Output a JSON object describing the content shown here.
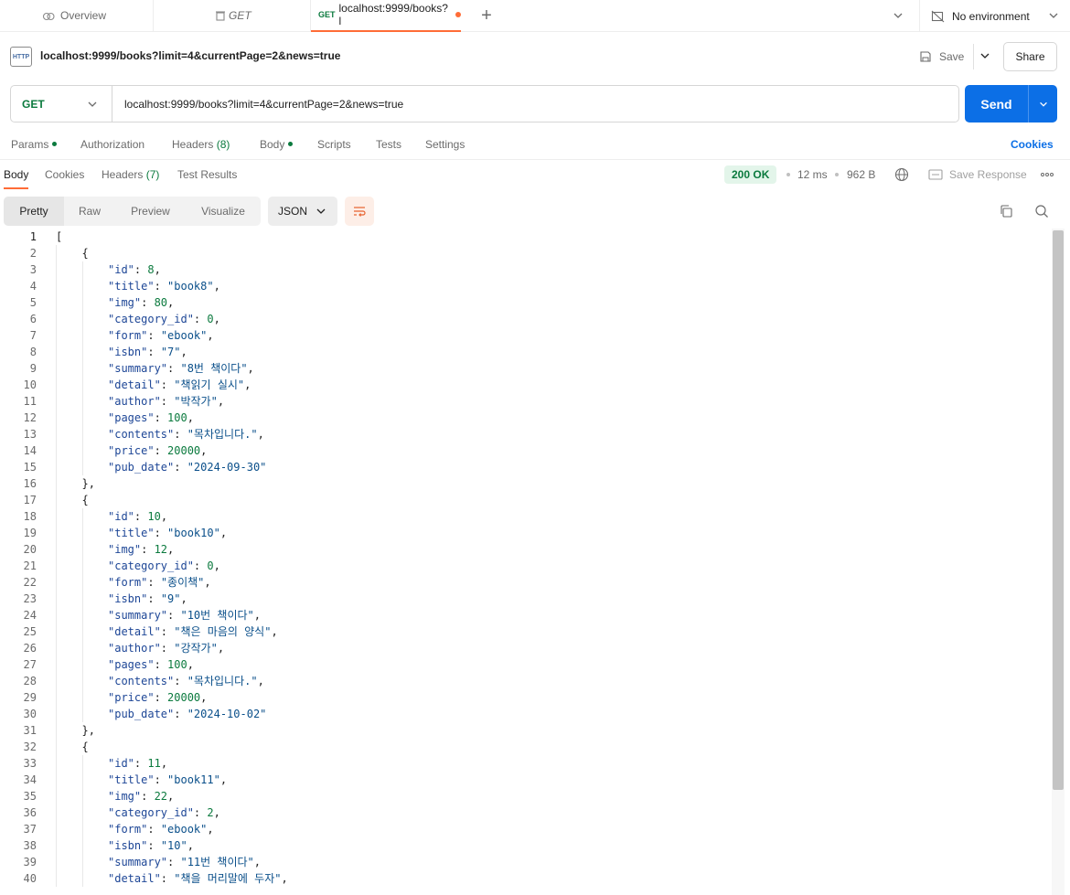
{
  "tabs": {
    "overview_label": "Overview",
    "get_label": "GET",
    "active": {
      "method": "GET",
      "label": "localhost:9999/books?l"
    }
  },
  "environment": {
    "label": "No environment"
  },
  "request": {
    "title": "localhost:9999/books?limit=4&currentPage=2&news=true",
    "http_badge": "HTTP",
    "save_label": "Save",
    "share_label": "Share",
    "method": "GET",
    "url": "localhost:9999/books?limit=4&currentPage=2&news=true",
    "send_label": "Send"
  },
  "request_tabs": {
    "params": "Params",
    "authorization": "Authorization",
    "headers": "Headers",
    "headers_count": "(8)",
    "body": "Body",
    "scripts": "Scripts",
    "tests": "Tests",
    "settings": "Settings",
    "cookies": "Cookies"
  },
  "response_tabs": {
    "body": "Body",
    "cookies": "Cookies",
    "headers": "Headers",
    "headers_count": "(7)",
    "test_results": "Test Results",
    "status": "200 OK",
    "time": "12 ms",
    "size": "962 B",
    "save_response": "Save Response"
  },
  "viewer": {
    "modes": [
      "Pretty",
      "Raw",
      "Preview",
      "Visualize"
    ],
    "format": "JSON"
  },
  "colors": {
    "accent": "#ff6c37",
    "send": "#0c6fe6",
    "status_ok": "#0b7a3e"
  },
  "code_lines": [
    {
      "indent": 0,
      "text": "["
    },
    {
      "indent": 1,
      "text": "{"
    },
    {
      "indent": 2,
      "key": "id",
      "value": "8",
      "type": "n",
      "comma": true
    },
    {
      "indent": 2,
      "key": "title",
      "value": "\"book8\"",
      "type": "s",
      "comma": true
    },
    {
      "indent": 2,
      "key": "img",
      "value": "80",
      "type": "n",
      "comma": true
    },
    {
      "indent": 2,
      "key": "category_id",
      "value": "0",
      "type": "n",
      "comma": true
    },
    {
      "indent": 2,
      "key": "form",
      "value": "\"ebook\"",
      "type": "s",
      "comma": true
    },
    {
      "indent": 2,
      "key": "isbn",
      "value": "\"7\"",
      "type": "s",
      "comma": true
    },
    {
      "indent": 2,
      "key": "summary",
      "value": "\"8번 책이다\"",
      "type": "s",
      "comma": true
    },
    {
      "indent": 2,
      "key": "detail",
      "value": "\"책읽기 실시\"",
      "type": "s",
      "comma": true
    },
    {
      "indent": 2,
      "key": "author",
      "value": "\"박작가\"",
      "type": "s",
      "comma": true
    },
    {
      "indent": 2,
      "key": "pages",
      "value": "100",
      "type": "n",
      "comma": true
    },
    {
      "indent": 2,
      "key": "contents",
      "value": "\"목차입니다.\"",
      "type": "s",
      "comma": true
    },
    {
      "indent": 2,
      "key": "price",
      "value": "20000",
      "type": "n",
      "comma": true
    },
    {
      "indent": 2,
      "key": "pub_date",
      "value": "\"2024-09-30\"",
      "type": "s",
      "comma": false
    },
    {
      "indent": 1,
      "text": "},"
    },
    {
      "indent": 1,
      "text": "{"
    },
    {
      "indent": 2,
      "key": "id",
      "value": "10",
      "type": "n",
      "comma": true
    },
    {
      "indent": 2,
      "key": "title",
      "value": "\"book10\"",
      "type": "s",
      "comma": true
    },
    {
      "indent": 2,
      "key": "img",
      "value": "12",
      "type": "n",
      "comma": true
    },
    {
      "indent": 2,
      "key": "category_id",
      "value": "0",
      "type": "n",
      "comma": true
    },
    {
      "indent": 2,
      "key": "form",
      "value": "\"종이책\"",
      "type": "s",
      "comma": true
    },
    {
      "indent": 2,
      "key": "isbn",
      "value": "\"9\"",
      "type": "s",
      "comma": true
    },
    {
      "indent": 2,
      "key": "summary",
      "value": "\"10번 책이다\"",
      "type": "s",
      "comma": true
    },
    {
      "indent": 2,
      "key": "detail",
      "value": "\"책은 마음의 양식\"",
      "type": "s",
      "comma": true
    },
    {
      "indent": 2,
      "key": "author",
      "value": "\"강작가\"",
      "type": "s",
      "comma": true
    },
    {
      "indent": 2,
      "key": "pages",
      "value": "100",
      "type": "n",
      "comma": true
    },
    {
      "indent": 2,
      "key": "contents",
      "value": "\"목차입니다.\"",
      "type": "s",
      "comma": true
    },
    {
      "indent": 2,
      "key": "price",
      "value": "20000",
      "type": "n",
      "comma": true
    },
    {
      "indent": 2,
      "key": "pub_date",
      "value": "\"2024-10-02\"",
      "type": "s",
      "comma": false
    },
    {
      "indent": 1,
      "text": "},"
    },
    {
      "indent": 1,
      "text": "{"
    },
    {
      "indent": 2,
      "key": "id",
      "value": "11",
      "type": "n",
      "comma": true
    },
    {
      "indent": 2,
      "key": "title",
      "value": "\"book11\"",
      "type": "s",
      "comma": true
    },
    {
      "indent": 2,
      "key": "img",
      "value": "22",
      "type": "n",
      "comma": true
    },
    {
      "indent": 2,
      "key": "category_id",
      "value": "2",
      "type": "n",
      "comma": true
    },
    {
      "indent": 2,
      "key": "form",
      "value": "\"ebook\"",
      "type": "s",
      "comma": true
    },
    {
      "indent": 2,
      "key": "isbn",
      "value": "\"10\"",
      "type": "s",
      "comma": true
    },
    {
      "indent": 2,
      "key": "summary",
      "value": "\"11번 책이다\"",
      "type": "s",
      "comma": true
    },
    {
      "indent": 2,
      "key": "detail",
      "value": "\"책을 머리말에 두자\"",
      "type": "s",
      "comma": true
    }
  ]
}
